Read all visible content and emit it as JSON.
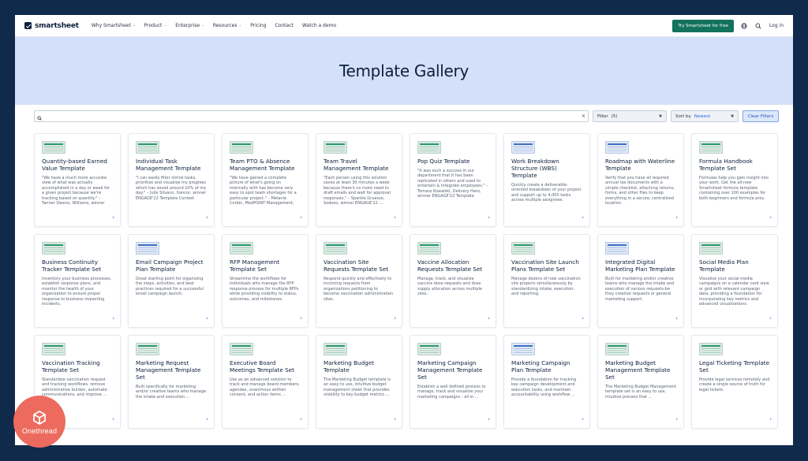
{
  "nav": {
    "brand": "smartsheet",
    "links": [
      {
        "label": "Why Smartsheet",
        "caret": true
      },
      {
        "label": "Product",
        "caret": true
      },
      {
        "label": "Enterprise",
        "caret": true
      },
      {
        "label": "Resources",
        "caret": true
      },
      {
        "label": "Pricing",
        "caret": false
      },
      {
        "label": "Contact",
        "caret": false
      },
      {
        "label": "Watch a demo",
        "caret": false
      }
    ],
    "cta": "Try Smartsheet for free",
    "login": "Log in"
  },
  "hero": {
    "title": "Template Gallery"
  },
  "filters": {
    "search_value": "",
    "filter_label": "Filter",
    "filter_count": "(5)",
    "sort_label": "Sort by",
    "sort_value": "Newest",
    "clear_label": "Clear Filters"
  },
  "cards": [
    {
      "title": "Quantity-based Earned Value Template",
      "desc": "\"We have a much more accurate view of what was actually accomplished in a day or week for a given project because we're tracking based on quantity.\" – Tanner Owens, Williams, winner ENGAGE'22 ...",
      "thumb": "green"
    },
    {
      "title": "Individual Task Management Template",
      "desc": "\"I can easily filter shrink tasks, prioritize and visualize my progress which has saved around 10% of my day.\" – Julie Silvano, Xancor, winner ENGAGE'22 Template Contest",
      "thumb": "green"
    },
    {
      "title": "Team PTO & Absence Management Template",
      "desc": "\"We have gained a complete picture of what's going on internally with has become very easy to spot team shortages for a particular project.\" – Melanie Corbin, MedPOINT Management, winner ENGAGE'...",
      "thumb": "green"
    },
    {
      "title": "Team Travel Management Template",
      "desc": "\"Each person using this solution saves at least 30 minutes a week because there's no more need to draft emails and wait for approval responses.\" – Sparkle Gruesso, Sodexo, winner ENGAGE'22 ...",
      "thumb": "green"
    },
    {
      "title": "Pop Quiz Template",
      "desc": "\"It was such a success in our department that it has been replicated in others and used to entertain & integrate employees.\" – Tomasz Kowalski, Delivery Hero, winner ENGAGE'22 Template Contest.",
      "thumb": "green"
    },
    {
      "title": "Work Breakdown Structure (WBS) Template",
      "desc": "Quickly create a deliverable-oriented breakdown of your project and support up to 4,000 tasks across multiple assignees.",
      "thumb": "blue"
    },
    {
      "title": "Roadmap with Waterline Template",
      "desc": "Verify that you have all required annual tax documents with a simple checklist, attaching returns, forms, and other files to keep everything in a secure, centralized location.",
      "thumb": "blue"
    },
    {
      "title": "Formula Handbook Template Set",
      "desc": "Formulas help you gain insight into your work. Get the all-new Smartsheet formula template containing over 100 examples for both beginners and formula pros.",
      "thumb": "green"
    },
    {
      "title": "Business Continuity Tracker Template Set",
      "desc": "Inventory your business processes, establish response plans, and monitor the health of your organization to ensure proper response to business impacting incidents.",
      "thumb": "green"
    },
    {
      "title": "Email Campaign Project Plan Template",
      "desc": "Great starting point for organizing the steps, activities, and best practices required for a successful email campaign launch.",
      "thumb": "blue"
    },
    {
      "title": "RFP Management Template Set",
      "desc": "Streamline the workflows for individuals who manage the RFP response process for multiple RFPs while providing visibility to status, outcomes, and milestones.",
      "thumb": "green"
    },
    {
      "title": "Vaccination Site Requests Template Set",
      "desc": "Respond quickly and effectively to incoming requests from organizations petitioning to become vaccination administration sites.",
      "thumb": "green"
    },
    {
      "title": "Vaccine Allocation Requests Template Set",
      "desc": "Manage, track, and visualize vaccine dose requests and dose supply allocation across multiple sites.",
      "thumb": "green"
    },
    {
      "title": "Vaccination Site Launch Plans Template Set",
      "desc": "Manage dozens of new vaccination site projects simultaneously by standardizing intake, execution, and reporting.",
      "thumb": "green"
    },
    {
      "title": "Integrated Digital Marketing Plan Template",
      "desc": "Built for marketing and/or creative teams who manage the intake and execution of various requests-be they creative requests or general marketing support.",
      "thumb": "blue"
    },
    {
      "title": "Social Media Plan Template",
      "desc": "Visualize your social media campaigns on a calendar card view or grid with relevant campaign data, providing a foundation for incorporating key metrics and advanced visualizations.",
      "thumb": "green"
    },
    {
      "title": "Vaccination Tracking Template Set",
      "desc": "Standardize vaccination request and tracking workflows, remove administrative burden, automate communications, and improve ...",
      "thumb": "green"
    },
    {
      "title": "Marketing Request Management Template Set",
      "desc": "Built specifically for marketing and/or creative teams who manage the intake and execution ...",
      "thumb": "green"
    },
    {
      "title": "Executive Board Meetings Template Set",
      "desc": "Use as an advanced solution to track and manage board members, agendas, unanimous written consent, and action items ...",
      "thumb": "green"
    },
    {
      "title": "Marketing Budget Template",
      "desc": "The Marketing Budget template is an easy to use, intuitive budget management sheet that provides visibility to key budget metrics ...",
      "thumb": "green"
    },
    {
      "title": "Marketing Campaign Management Template Set",
      "desc": "Establish a well defined process to manage, track and visualize your marketing campaigns - all in ...",
      "thumb": "green"
    },
    {
      "title": "Marketing Campaign Plan Template",
      "desc": "Provide a foundation for tracking key campaign development and execution tasks, and maintain accountability using workflow ...",
      "thumb": "blue"
    },
    {
      "title": "Marketing Budget Management Template Set",
      "desc": "The Marketing Budget Management template set is an easy to use, intuitive process that ...",
      "thumb": "green"
    },
    {
      "title": "Legal Ticketing Template Set",
      "desc": "Provide legal services remotely and create a single source of truth for legal tickets.",
      "thumb": "green"
    }
  ],
  "watermark": {
    "text": "Onethread"
  }
}
